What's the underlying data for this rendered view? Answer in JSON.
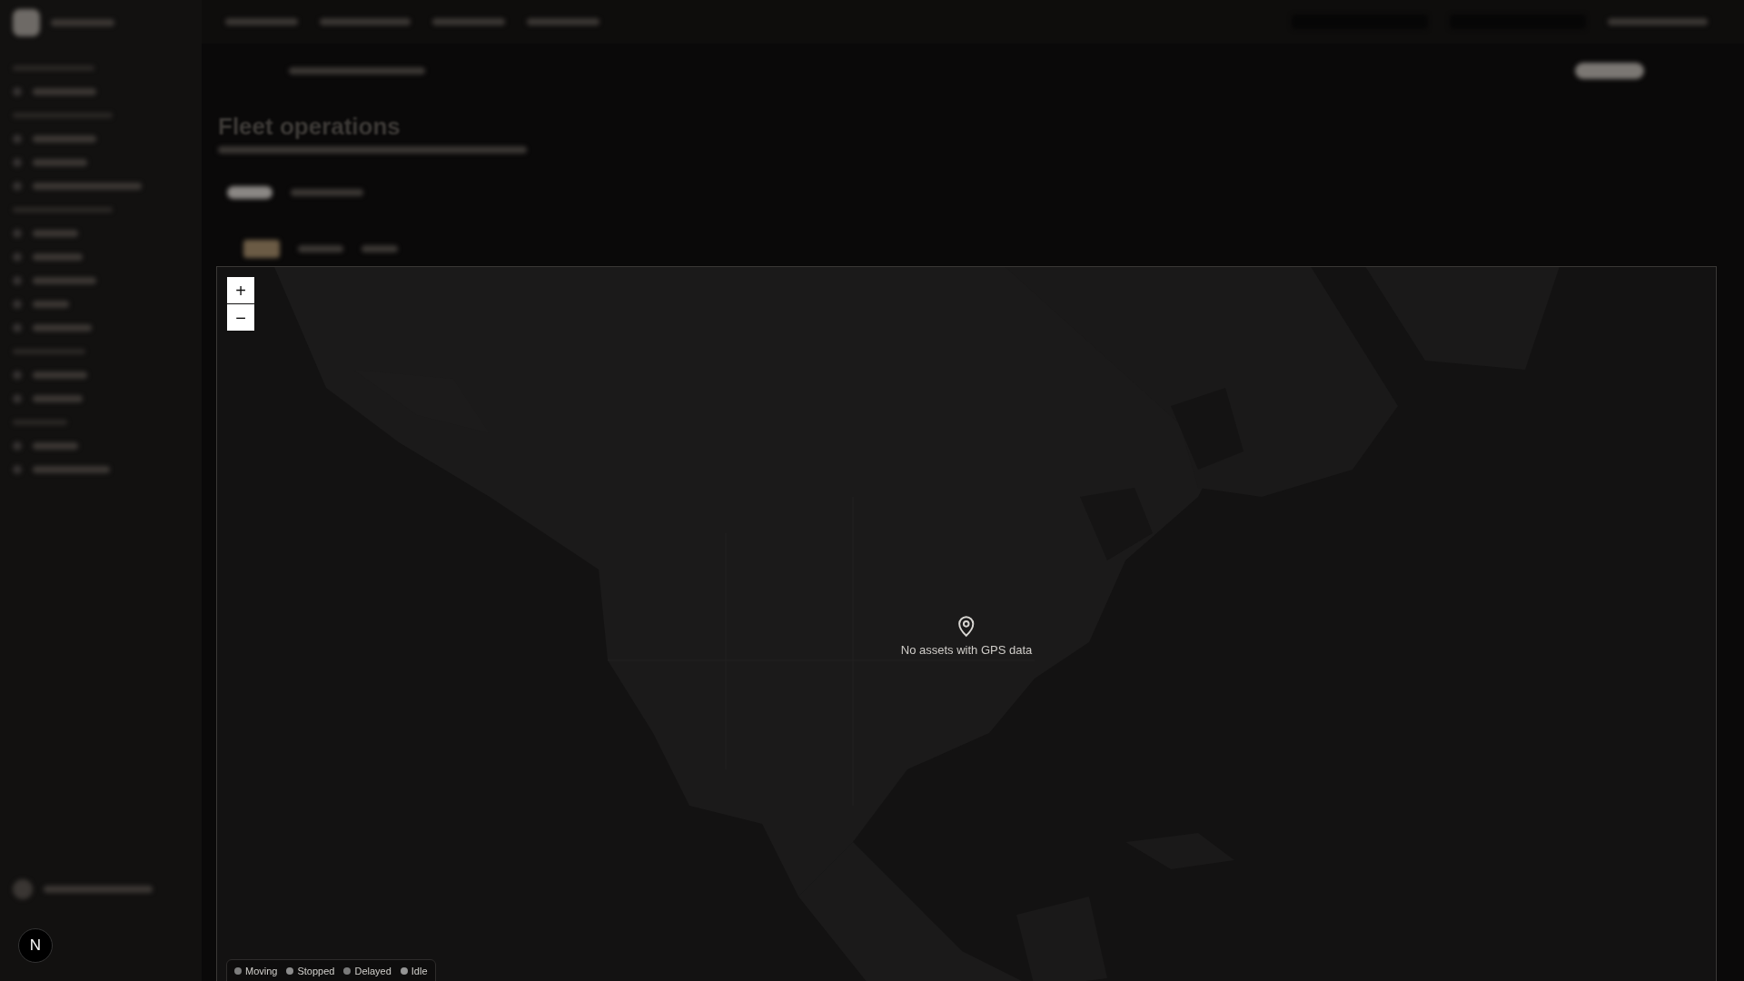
{
  "page": {
    "title": "Fleet operations"
  },
  "map": {
    "kind": "picture",
    "zoom_in": "+",
    "zoom_out": "−",
    "empty_message": "No assets with GPS data"
  },
  "legend": [
    {
      "label": "Moving",
      "color": "#7d7d7d"
    },
    {
      "label": "Stopped",
      "color": "#8c8c8c"
    },
    {
      "label": "Delayed",
      "color": "#7a7a7a"
    },
    {
      "label": "Idle",
      "color": "#959595"
    }
  ],
  "badge": {
    "letter": "N"
  }
}
